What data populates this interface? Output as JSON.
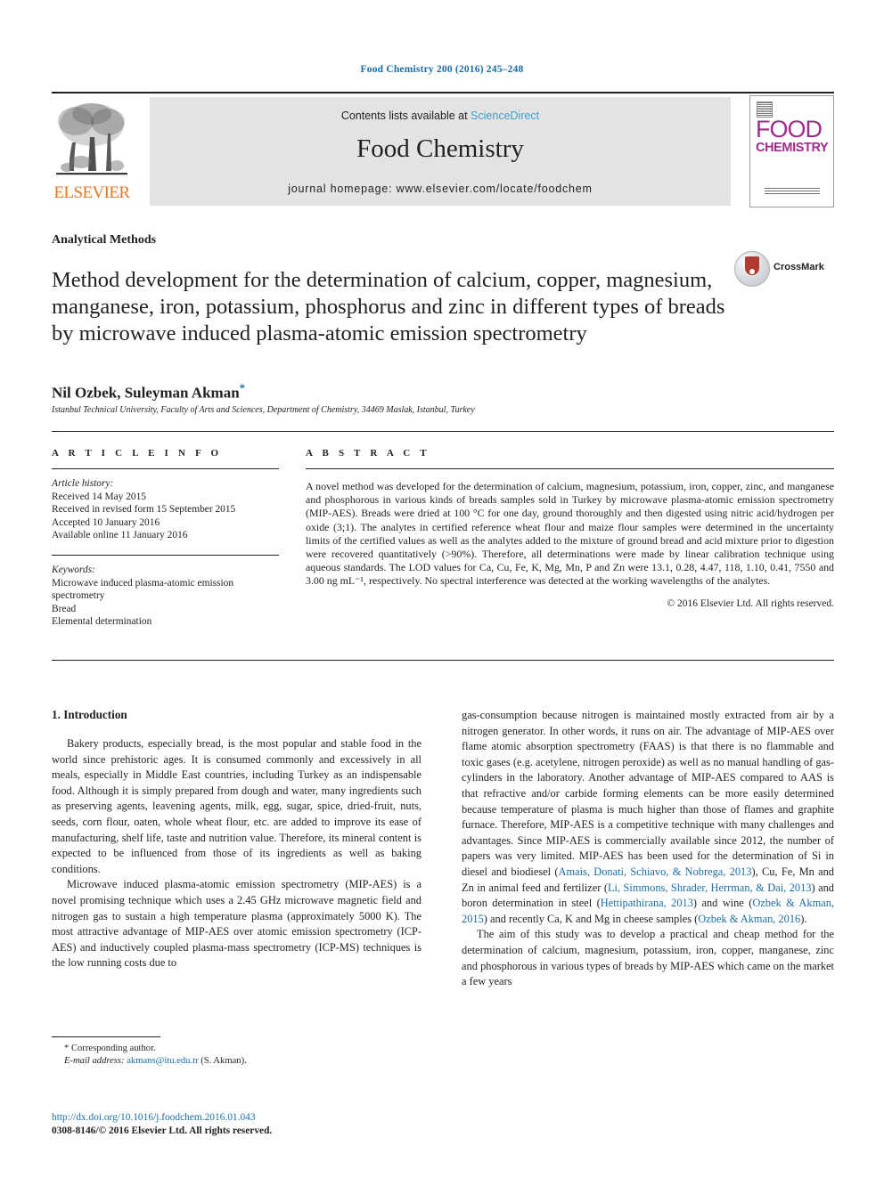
{
  "running_head": "Food Chemistry 200 (2016) 245–248",
  "masthead": {
    "publisher_name": "ELSEVIER",
    "contents_text": "Contents lists available at ",
    "sciencedirect_link": "ScienceDirect",
    "journal_title": "Food Chemistry",
    "homepage_text": "journal homepage: www.elsevier.com/locate/foodchem",
    "cover_word_top": "FOOD",
    "cover_word_bottom": "CHEMISTRY",
    "accent_blue": "#3f9fd0",
    "cover_magenta": "#9f2b8c",
    "elsevier_orange": "#E87722"
  },
  "article": {
    "section_kicker": "Analytical Methods",
    "title": "Method development for the determination of calcium, copper, magnesium, manganese, iron, potassium, phosphorus and zinc in different types of breads by microwave induced plasma-atomic emission spectrometry",
    "authors": "Nil Ozbek, Suleyman Akman",
    "corresponding_marker": "*",
    "affiliation": "Istanbul Technical University, Faculty of Arts and Sciences, Department of Chemistry, 34469 Maslak, Istanbul, Turkey",
    "crossmark_label": "CrossMark"
  },
  "article_info": {
    "heading": "A R T I C L E  I N F O",
    "history_label": "Article history:",
    "history": [
      "Received 14 May 2015",
      "Received in revised form 15 September 2015",
      "Accepted 10 January 2016",
      "Available online 11 January 2016"
    ],
    "keywords_label": "Keywords:",
    "keywords": [
      "Microwave induced plasma-atomic emission spectrometry",
      "Bread",
      "Elemental determination"
    ]
  },
  "abstract": {
    "heading": "A B S T R A C T",
    "text": "A novel method was developed for the determination of calcium, magnesium, potassium, iron, copper, zinc, and manganese and phosphorous in various kinds of breads samples sold in Turkey by microwave plasma-atomic emission spectrometry (MIP-AES). Breads were dried at 100 °C for one day, ground thoroughly and then digested using nitric acid/hydrogen per oxide (3;1). The analytes in certified reference wheat flour and maize flour samples were determined in the uncertainty limits of the certified values as well as the analytes added to the mixture of ground bread and acid mixture prior to digestion were recovered quantitatively (>90%). Therefore, all determinations were made by linear calibration technique using aqueous standards. The LOD values for Ca, Cu, Fe, K, Mg, Mn, P and Zn were 13.1, 0.28, 4.47, 118, 1.10, 0.41, 7550 and 3.00 ng mL⁻¹, respectively. No spectral interference was detected at the working wavelengths of the analytes.",
    "copyright": "© 2016 Elsevier Ltd. All rights reserved."
  },
  "introduction": {
    "heading": "1. Introduction",
    "left_paragraphs": [
      "Bakery products, especially bread, is the most popular and stable food in the world since prehistoric ages. It is consumed commonly and excessively in all meals, especially in Middle East countries, including Turkey as an indispensable food. Although it is simply prepared from dough and water, many ingredients such as preserving agents, leavening agents, milk, egg, sugar, spice, dried-fruit, nuts, seeds, corn flour, oaten, whole wheat flour, etc. are added to improve its ease of manufacturing, shelf life, taste and nutrition value. Therefore, its mineral content is expected to be influenced from those of its ingredients as well as baking conditions.",
      "Microwave induced plasma-atomic emission spectrometry (MIP-AES) is a novel promising technique which uses a 2.45 GHz microwave magnetic field and nitrogen gas to sustain a high temperature plasma (approximately 5000 K). The most attractive advantage of MIP-AES over atomic emission spectrometry (ICP-AES) and inductively coupled plasma-mass spectrometry (ICP-MS) techniques is the low running costs due to"
    ],
    "right_paragraph_1_parts": [
      {
        "text": "gas-consumption because nitrogen is maintained mostly extracted from air by a nitrogen generator. In other words, it runs on air. The advantage of MIP-AES over flame atomic absorption spectrometry (FAAS) is that there is no flammable and toxic gases (e.g. acetylene, nitrogen peroxide) as well as no manual handling of gas-cylinders in the laboratory. Another advantage of MIP-AES compared to AAS is that refractive and/or carbide forming elements can be more easily determined because temperature of plasma is much higher than those of flames and graphite furnace. Therefore, MIP-AES is a competitive technique with many challenges and advantages. Since MIP-AES is commercially available since 2012, the number of papers was very limited. MIP-AES has been used for the determination of Si in diesel and biodiesel (",
        "type": "plain"
      },
      {
        "text": "Amais, Donati, Schiavo, & Nobrega, 2013",
        "type": "ref"
      },
      {
        "text": "), Cu, Fe, Mn and Zn in animal feed and fertilizer (",
        "type": "plain"
      },
      {
        "text": "Li, Simmons, Shrader, Herrman, & Dai, 2013",
        "type": "ref"
      },
      {
        "text": ") and boron determination in steel (",
        "type": "plain"
      },
      {
        "text": "Hettipathirana, 2013",
        "type": "ref"
      },
      {
        "text": ") and wine (",
        "type": "plain"
      },
      {
        "text": "Ozbek & Akman, 2015",
        "type": "ref"
      },
      {
        "text": ") and recently Ca, K and Mg in cheese samples (",
        "type": "plain"
      },
      {
        "text": "Ozbek & Akman, 2016",
        "type": "ref"
      },
      {
        "text": ").",
        "type": "plain"
      }
    ],
    "right_paragraph_2": "The aim of this study was to develop a practical and cheap method for the determination of calcium, magnesium, potassium, iron, copper, manganese, zinc and phosphorous in various types of breads by MIP-AES which came on the market a few years"
  },
  "footnote": {
    "corresponding_author": "* Corresponding author.",
    "email_label": "E-mail address:",
    "email": "akmans@itu.edu.tr",
    "email_suffix": "(S. Akman)."
  },
  "footer": {
    "doi": "http://dx.doi.org/10.1016/j.foodchem.2016.01.043",
    "issn_line": "0308-8146/© 2016 Elsevier Ltd. All rights reserved."
  }
}
